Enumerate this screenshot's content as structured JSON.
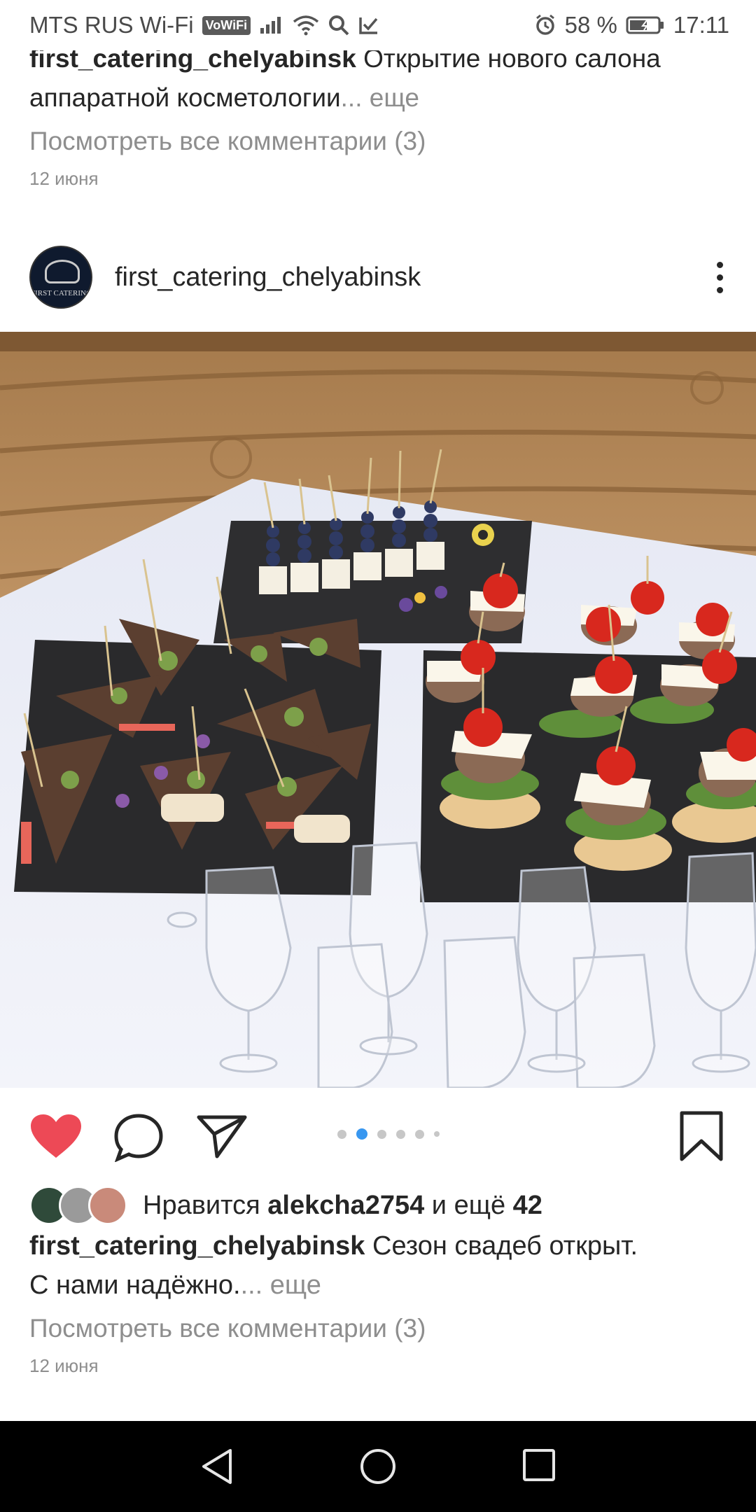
{
  "status_bar": {
    "carrier": "MTS RUS Wi-Fi",
    "vowifi": "VoWiFi",
    "battery": "58 %",
    "time": "17:11"
  },
  "previous_post": {
    "username": "first_catering_chelyabinsk",
    "caption": " Открытие нового салона",
    "caption_line2": "аппаратной косметологии",
    "more": "... еще",
    "comments_link": "Посмотреть все комментарии (3)",
    "date": "12 июня"
  },
  "post": {
    "username": "first_catering_chelyabinsk",
    "avatar_text": "FIRST CATERING",
    "likes_prefix": "Нравится ",
    "likes_user": "alekcha2754",
    "likes_middle": " и ещё ",
    "likes_count": "42",
    "caption_user": "first_catering_chelyabinsk",
    "caption_text": " Сезон свадеб открыт.",
    "caption_line2": "С нами надёжно.",
    "more": "... еще",
    "comments_link": "Посмотреть все комментарии (3)",
    "date": "12 июня",
    "carousel_active_index": 1,
    "carousel_count": 6
  },
  "colors": {
    "like_red": "#ed4956",
    "carousel_blue": "#3897f0",
    "secondary_text": "#8e8e8e"
  },
  "icons": [
    "heart-icon",
    "comment-icon",
    "share-icon",
    "bookmark-icon",
    "more-options-icon",
    "back-icon",
    "home-icon",
    "recents-icon"
  ]
}
